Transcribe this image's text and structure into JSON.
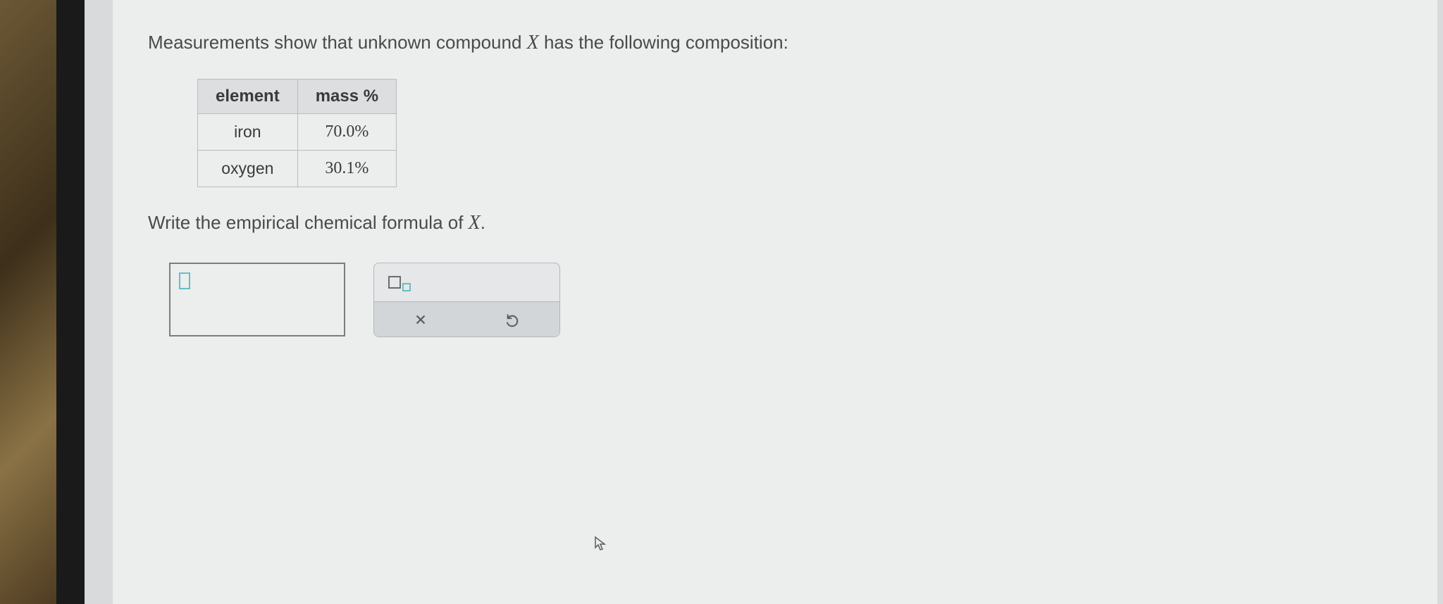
{
  "prompt": {
    "prefix": "Measurements show that unknown compound ",
    "variable": "X",
    "suffix": " has the following composition:"
  },
  "table": {
    "headers": [
      "element",
      "mass %"
    ],
    "rows": [
      [
        "iron",
        "70.0%"
      ],
      [
        "oxygen",
        "30.1%"
      ]
    ]
  },
  "instruction": {
    "prefix": "Write the empirical chemical formula of ",
    "variable": "X",
    "suffix": "."
  }
}
